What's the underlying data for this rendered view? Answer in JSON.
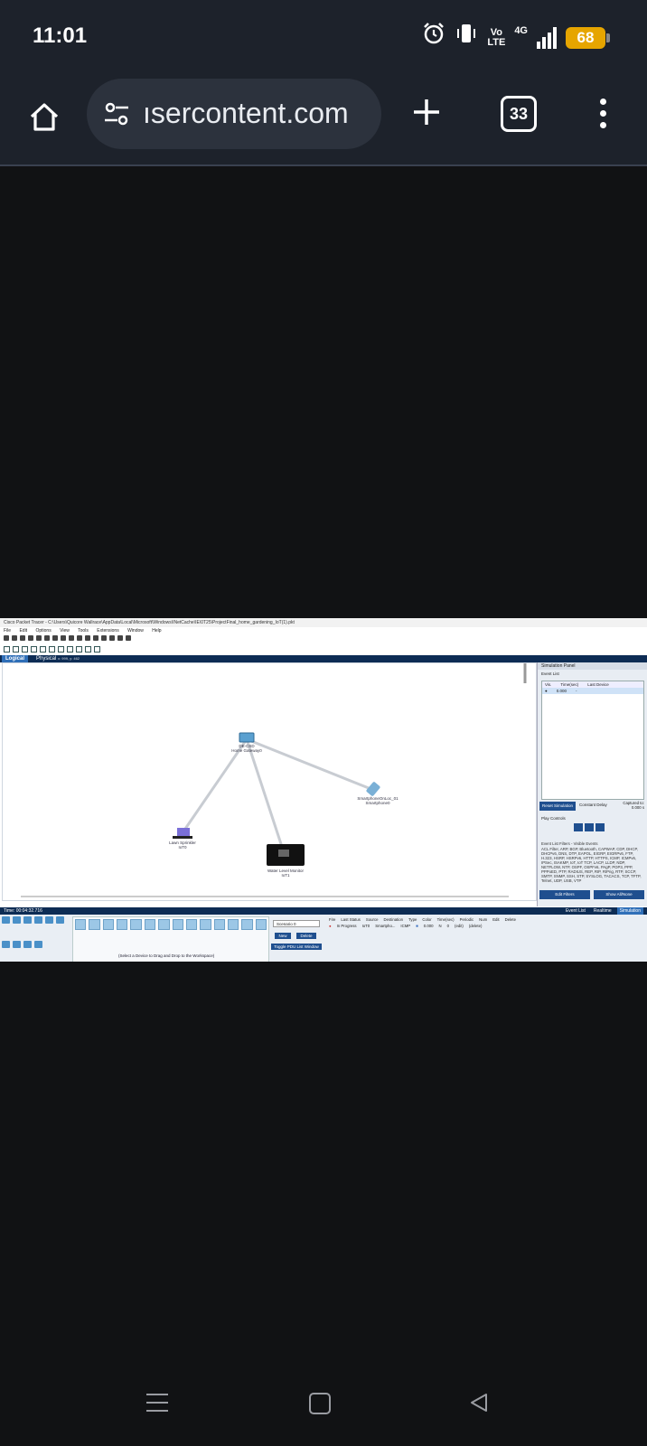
{
  "status_bar": {
    "time": "11:01",
    "volte_top": "Vo",
    "volte_bottom": "LTE",
    "network": "4G",
    "battery": "68"
  },
  "browser": {
    "url": "ısercontent.com",
    "tab_count": "33"
  },
  "packet_tracer": {
    "title": "Cisco Packet Tracer - C:\\Users\\Quicore Wallrace\\AppData\\Local\\Microsoft\\Windows\\INetCache\\IE\\0T25\\ProjectFinal_home_gardening_IoT(1).pkt",
    "menu": [
      "File",
      "Edit",
      "Options",
      "View",
      "Tools",
      "Extensions",
      "Window",
      "Help"
    ],
    "tab_logical": "Logical",
    "tab_physical": "Physical",
    "tab_coords": "x: 999, y: 462",
    "nodes": {
      "gateway_label_1": "DE-CSD",
      "gateway_label_2": "Home Gateway0",
      "sprinkler_label_1": "Lawn Sprinkler",
      "sprinkler_label_2": "IoT0",
      "sensor_label_1": "Water Level Monitor",
      "sensor_label_2": "IoT1",
      "device_label_1": "SmartphoneOnLoc_01",
      "device_label_2": "Smartphone0"
    },
    "simulation_panel": {
      "title": "Simulation Panel",
      "event_list": "Event List",
      "col_vis": "Vis.",
      "col_time": "Time(sec)",
      "col_last": "Last Device",
      "event_time": "0.000",
      "reset_btn": "Reset Simulation",
      "constant_delay": "Constant Delay",
      "captured": "Captured to:",
      "captured_value": "0.000 s",
      "play_controls": "Play Controls",
      "filters_title": "Event List Filters - Visible Events",
      "filters_text": "ACL Filter, ARP, BGP, Bluetooth, CAPWAP, CDP, DHCP, DHCPv6, DNS, DTP, EAPOL, EIGRP, EIGRPv6, FTP, H.323, HSRP, HSRPv6, HTTP, HTTPS, ICMP, ICMPv6, IPSec, ISAKMP, IoT, IoT TCP, LACP, LLDP, NDP, NETFLOW, NTP, OSPF, OSPFv6, PAgP, POP3, PPP, PPPoED, PTP, RADIUS, REP, RIP, RIPng, RTP, SCCP, SMTP, SNMP, SSH, STP, SYSLOG, TACACS, TCP, TFTP, Telnet, UDP, USB, VTP",
      "edit_filters": "Edit Filters",
      "show_all": "Show All/None"
    },
    "bottom": {
      "time": "Time: 00:04:32.716",
      "realtime": "Realtime",
      "simulation": "Simulation",
      "event_list": "Event List",
      "drag_hint": "(Select a Device to Drag and Drop to the Workspace)",
      "scenario": "Scenario 0",
      "new_btn": "New",
      "delete_btn": "Delete",
      "toggle_pdu": "Toggle PDU List Window",
      "pdu_headers": [
        "Fire",
        "Last Status",
        "Source",
        "Destination",
        "Type",
        "Color",
        "Time(sec)",
        "Periodic",
        "Num",
        "Edit",
        "Delete"
      ],
      "pdu_row": [
        "●",
        "In Progress",
        "IoT0",
        "Smartpho...",
        "ICMP",
        "■",
        "0.000",
        "N",
        "0",
        "(edit)",
        "(delete)"
      ]
    }
  }
}
